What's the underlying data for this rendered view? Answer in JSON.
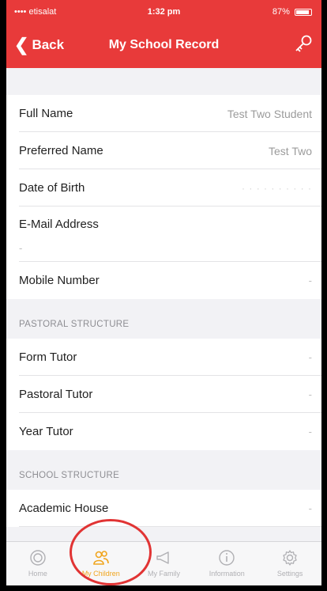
{
  "status_bar": {
    "carrier": "•••• etisalat",
    "time": "1:32 pm",
    "battery": "87%"
  },
  "nav": {
    "back_label": "Back",
    "title": "My School Record"
  },
  "personal": {
    "full_name_label": "Full Name",
    "full_name_value": "Test Two Student",
    "preferred_name_label": "Preferred Name",
    "preferred_name_value": "Test Two",
    "dob_label": "Date of Birth",
    "dob_value": "· · · · · · · · · ·",
    "email_label": "E-Mail Address",
    "email_value": "-",
    "mobile_label": "Mobile Number",
    "mobile_value": "-"
  },
  "pastoral": {
    "header": "PASTORAL STRUCTURE",
    "form_tutor_label": "Form Tutor",
    "form_tutor_value": "-",
    "pastoral_tutor_label": "Pastoral Tutor",
    "pastoral_tutor_value": "-",
    "year_tutor_label": "Year Tutor",
    "year_tutor_value": "-"
  },
  "school": {
    "header": "SCHOOL STRUCTURE",
    "academic_house_label": "Academic House",
    "academic_house_value": "-"
  },
  "tabs": [
    {
      "label": "Home",
      "icon": "home-icon"
    },
    {
      "label": "My Children",
      "icon": "children-icon"
    },
    {
      "label": "My Family",
      "icon": "megaphone-icon"
    },
    {
      "label": "Information",
      "icon": "info-icon"
    },
    {
      "label": "Settings",
      "icon": "gear-icon"
    }
  ],
  "colors": {
    "accent": "#e83a3a",
    "active_tab": "#f0a51e",
    "annotation_circle": "#e13434"
  }
}
